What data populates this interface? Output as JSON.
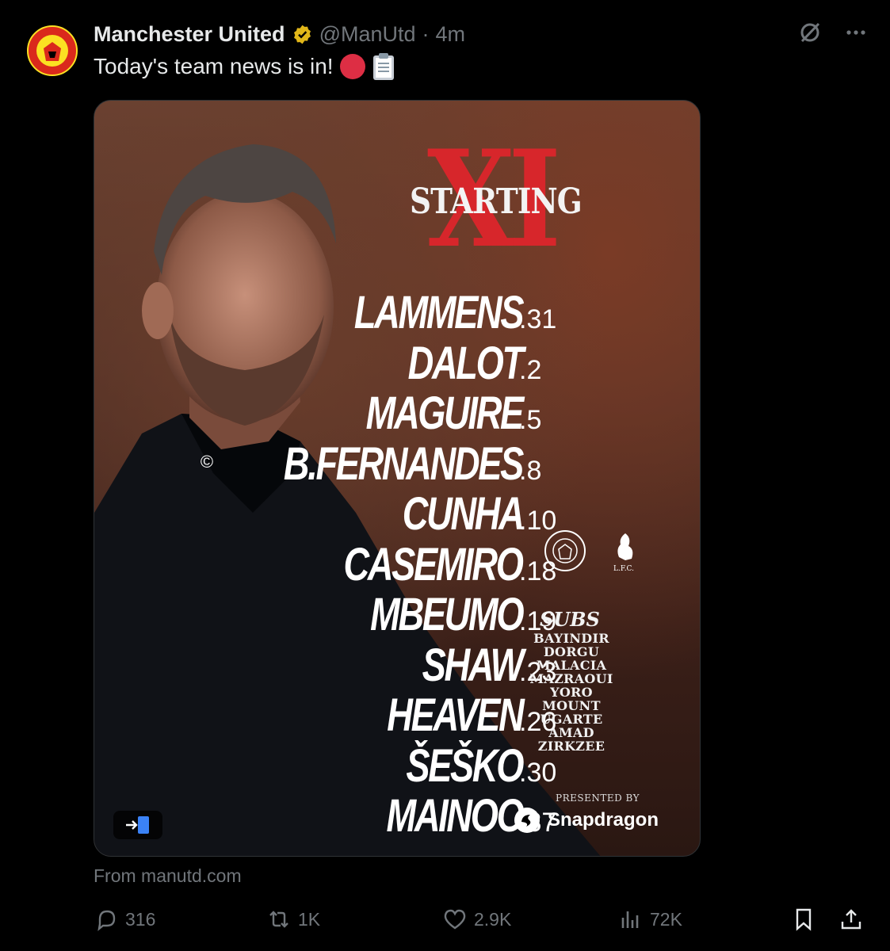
{
  "author": {
    "name": "Manchester United",
    "handle": "@ManUtd",
    "separator": "·",
    "time": "4m"
  },
  "tweet_text": "Today's team news is in!",
  "graphic": {
    "xi": "XI",
    "starting": "STARTING",
    "players": [
      {
        "name": "LAMMENS",
        "number": ".31",
        "captain": false
      },
      {
        "name": "DALOT",
        "number": ".2",
        "captain": false
      },
      {
        "name": "MAGUIRE",
        "number": ".5",
        "captain": false
      },
      {
        "name": "B.FERNANDES",
        "number": ".8",
        "captain": true
      },
      {
        "name": "CUNHA",
        "number": ".10",
        "captain": false
      },
      {
        "name": "CASEMIRO",
        "number": ".18",
        "captain": false
      },
      {
        "name": "MBEUMO",
        "number": ".19",
        "captain": false
      },
      {
        "name": "SHAW",
        "number": ".23",
        "captain": false
      },
      {
        "name": "HEAVEN",
        "number": ".26",
        "captain": false
      },
      {
        "name": "ŠEŠKO",
        "number": ".30",
        "captain": false
      },
      {
        "name": "MAINOO",
        "number": ".37",
        "captain": false
      }
    ],
    "captain_mark": "©",
    "subs_title": "SUBS",
    "subs": [
      "BAYINDIR",
      "DORGU",
      "MALACIA",
      "MAZRAOUI",
      "YORO",
      "MOUNT",
      "UGARTE",
      "AMAD",
      "ZIRKZEE"
    ],
    "crest_away_label": "L.F.C.",
    "presented_by": "PRESENTED BY",
    "sponsor": "Snapdragon"
  },
  "source": "From manutd.com",
  "actions": {
    "replies": "316",
    "reposts": "1K",
    "likes": "2.9K",
    "views": "72K"
  },
  "colors": {
    "background": "#000000",
    "text": "#e7e9ea",
    "muted": "#71767b",
    "accent_red": "#d7262b",
    "verified_gold": "#e2b719"
  },
  "icons": [
    "man-utd-crest-icon",
    "verified-badge-icon",
    "grok-icon",
    "more-icon",
    "red-circle-emoji-icon",
    "clipboard-emoji-icon",
    "reply-icon",
    "repost-icon",
    "like-icon",
    "views-icon",
    "bookmark-icon",
    "share-icon",
    "exit-fullscreen-icon",
    "snapdragon-icon",
    "lfc-liverbird-icon"
  ]
}
